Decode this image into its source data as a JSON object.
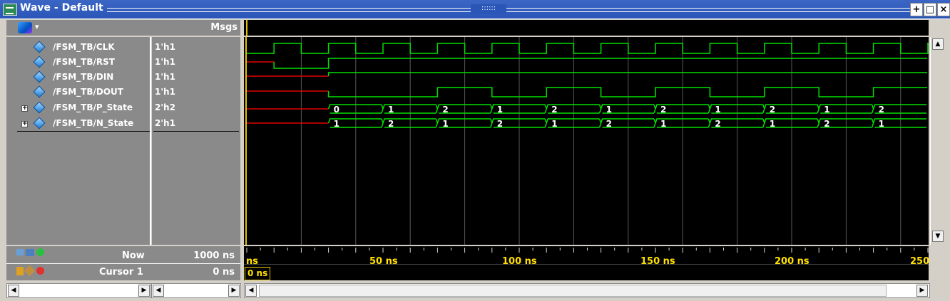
{
  "window": {
    "title": "Wave - Default",
    "grip": "::::::",
    "buttons": [
      "+",
      "□",
      "×"
    ]
  },
  "columns": {
    "msgs_header": "Msgs"
  },
  "signals": [
    {
      "name": "/FSM_TB/CLK",
      "value": "1'h1",
      "expandable": false
    },
    {
      "name": "/FSM_TB/RST",
      "value": "1'h1",
      "expandable": false
    },
    {
      "name": "/FSM_TB/DIN",
      "value": "1'h1",
      "expandable": false
    },
    {
      "name": "/FSM_TB/DOUT",
      "value": "1'h1",
      "expandable": false
    },
    {
      "name": "/FSM_TB/P_State",
      "value": "2'h2",
      "expandable": true
    },
    {
      "name": "/FSM_TB/N_State",
      "value": "2'h1",
      "expandable": true
    }
  ],
  "bus_values": {
    "p_state": [
      "0",
      "1",
      "2",
      "1",
      "2",
      "1",
      "2",
      "1",
      "2",
      "1",
      "2"
    ],
    "n_state": [
      "1",
      "2",
      "1",
      "2",
      "1",
      "2",
      "1",
      "2",
      "1",
      "2",
      "1"
    ]
  },
  "status": {
    "now_label": "Now",
    "now_value": "1000 ns",
    "cursor_label": "Cursor 1",
    "cursor_value": "0 ns",
    "cursor_box": "0 ns"
  },
  "timeline": {
    "labels": [
      "ns",
      "50 ns",
      "100 ns",
      "150 ns",
      "200 ns",
      "250"
    ]
  },
  "colors": {
    "signal_green": "#00e000",
    "signal_red": "#e00000",
    "cursor_yellow": "#e8c200",
    "panel_gray": "#8a8a8a",
    "title_blue": "#2a56b8"
  }
}
